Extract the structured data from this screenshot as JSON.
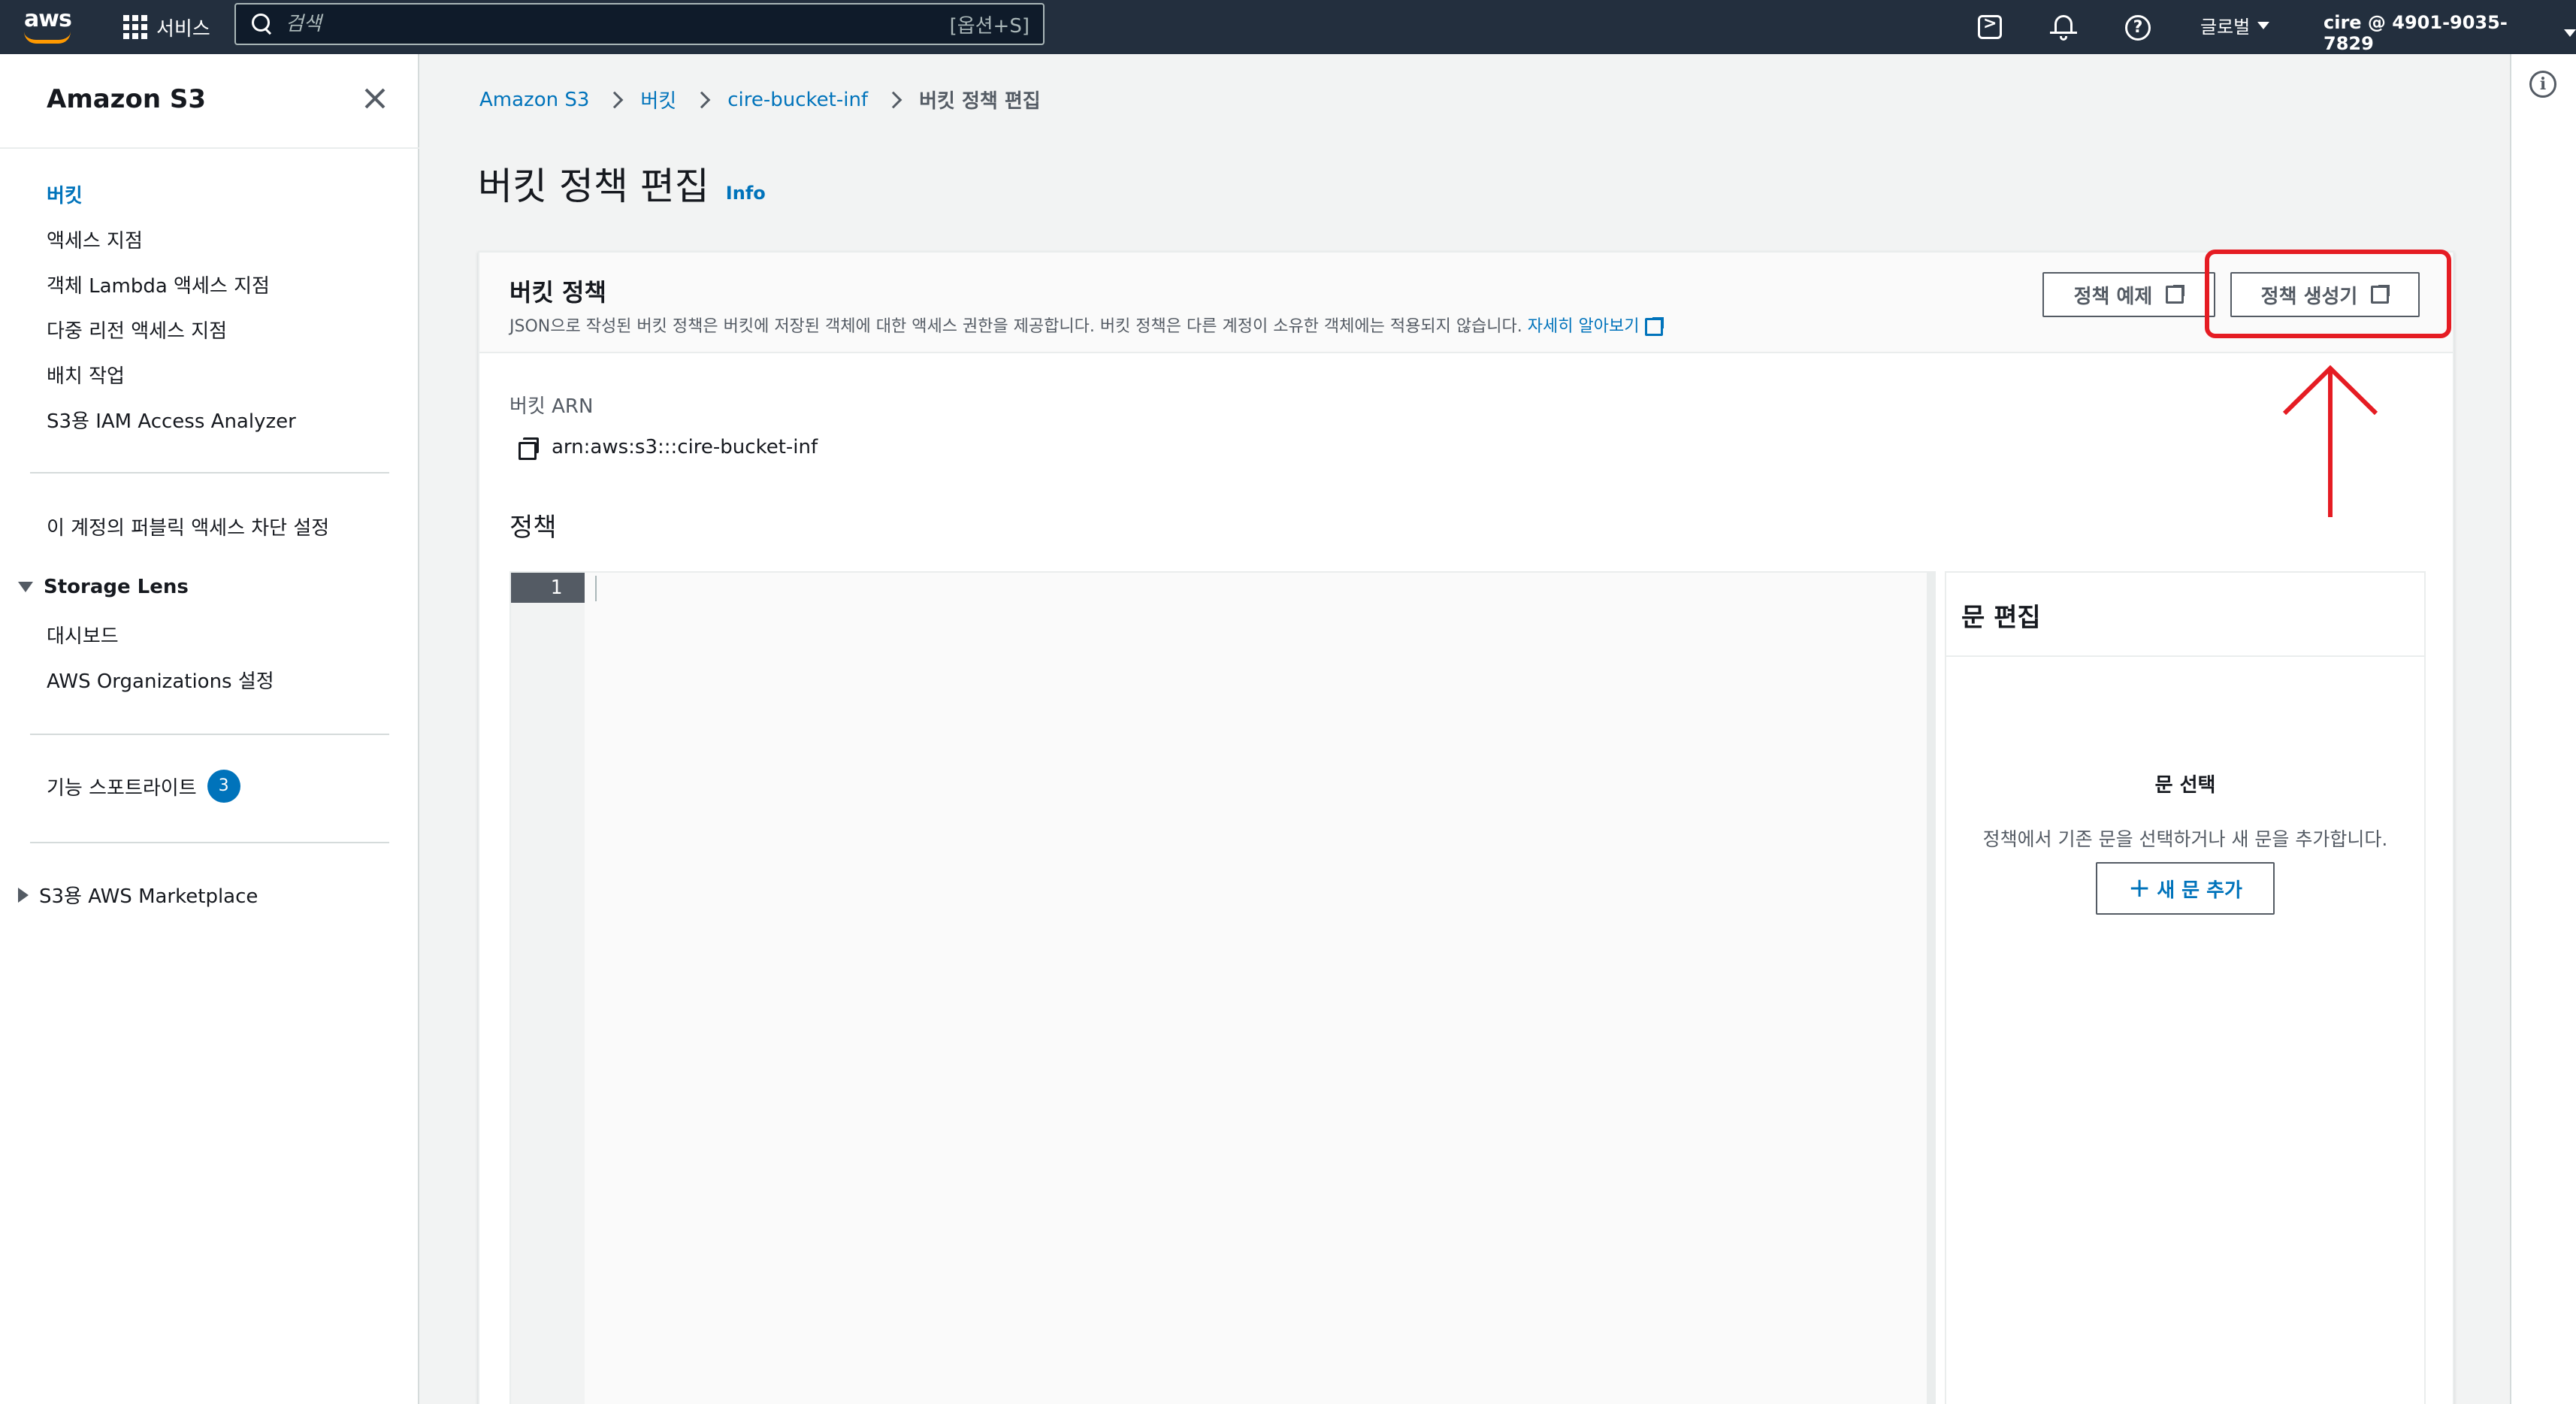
{
  "topnav": {
    "logo_text": "aws",
    "services_label": "서비스",
    "search_placeholder": "검색",
    "search_shortcut": "[옵션+S]",
    "region_label": "글로벌",
    "account_label": "cire @ 4901-9035-7829"
  },
  "sidebar": {
    "title": "Amazon S3",
    "items": [
      "버킷",
      "액세스 지점",
      "객체 Lambda 액세스 지점",
      "다중 리전 액세스 지점",
      "배치 작업",
      "S3용 IAM Access Analyzer"
    ],
    "public_block": "이 계정의 퍼블릭 액세스 차단 설정",
    "storage_lens": {
      "label": "Storage Lens",
      "items": [
        "대시보드",
        "AWS Organizations 설정"
      ]
    },
    "feature_spotlight": {
      "label": "기능 스포트라이트",
      "count": "3"
    },
    "marketplace": "S3용 AWS Marketplace"
  },
  "breadcrumb": [
    "Amazon S3",
    "버킷",
    "cire-bucket-inf",
    "버킷 정책 편집"
  ],
  "page": {
    "title": "버킷 정책 편집",
    "info": "Info"
  },
  "panel": {
    "title": "버킷 정책",
    "description": "JSON으로 작성된 버킷 정책은 버킷에 저장된 객체에 대한 액세스 권한을 제공합니다. 버킷 정책은 다른 계정이 소유한 객체에는 적용되지 않습니다.",
    "learn_more": "자세히 알아보기",
    "examples_button": "정책 예제",
    "generator_button": "정책 생성기",
    "arn_label": "버킷 ARN",
    "arn_value": "arn:aws:s3:::cire-bucket-inf",
    "policy_label": "정책",
    "line_number": "1"
  },
  "statement_panel": {
    "title": "문 편집",
    "subtitle": "문 선택",
    "description": "정책에서 기존 문을 선택하거나 새 문을 추가합니다.",
    "add_button": "새 문 추가"
  },
  "colors": {
    "nav_bg": "#232f3e",
    "link": "#0073bb",
    "annotation": "#e51c23",
    "aws_orange": "#ff9900"
  }
}
